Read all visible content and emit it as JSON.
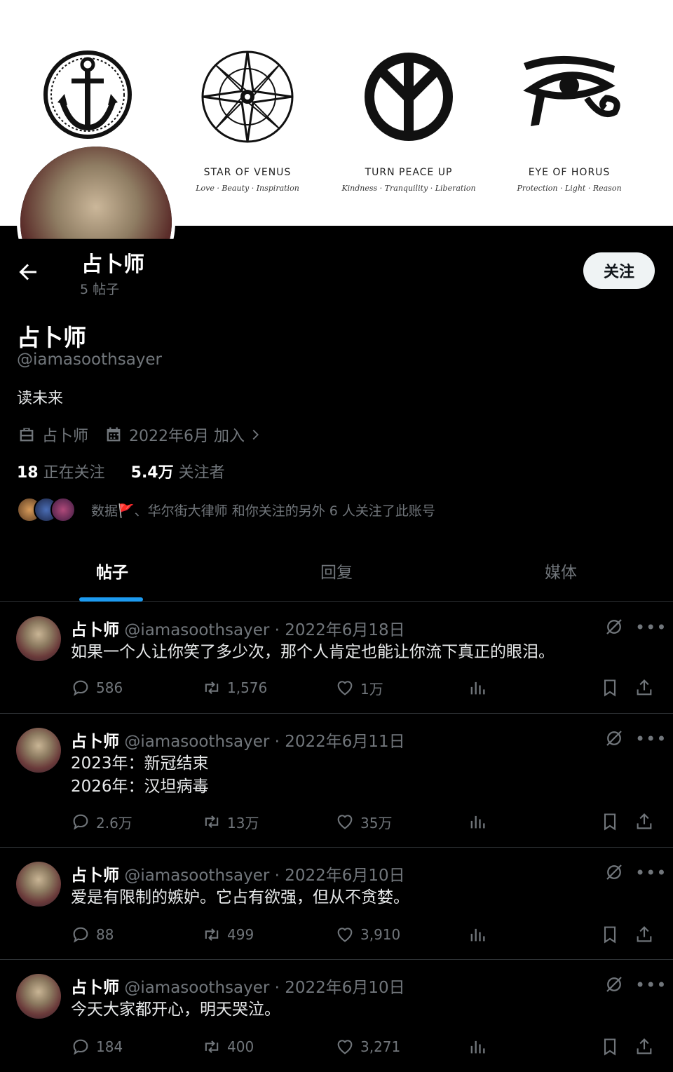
{
  "banner": {
    "symbols": [
      {
        "icon": "anchor-icon",
        "title": "",
        "subtitle": ""
      },
      {
        "icon": "compass-star-icon",
        "title": "STAR OF VENUS",
        "subtitle": "Love · Beauty · Inspiration"
      },
      {
        "icon": "peace-sign-icon",
        "title": "TURN PEACE UP",
        "subtitle": "Kindness · Tranquility · Liberation"
      },
      {
        "icon": "eye-of-horus-icon",
        "title": "EYE OF HORUS",
        "subtitle": "Protection · Light · Reason"
      }
    ]
  },
  "header": {
    "name": "占卜师",
    "post_count": "5 帖子",
    "follow_label": "关注"
  },
  "profile": {
    "name": "占卜师",
    "handle": "@iamasoothsayer",
    "bio": "读未来",
    "job": "占卜师",
    "joined": "2022年6月 加入",
    "following_count": "18",
    "following_label": "正在关注",
    "followers_count": "5.4万",
    "followers_label": "关注者",
    "known_followers": "数据🚩、华尔街大律师 和你关注的另外 6 人关注了此账号"
  },
  "tabs": [
    {
      "label": "帖子",
      "active": true
    },
    {
      "label": "回复",
      "active": false
    },
    {
      "label": "媒体",
      "active": false
    }
  ],
  "posts": [
    {
      "name": "占卜师",
      "meta": "@iamasoothsayer · 2022年6月18日",
      "lines": [
        "如果一个人让你笑了多少次，那个人肯定也能让你流下真正的眼泪。"
      ],
      "replies": "586",
      "reposts": "1,576",
      "likes": "1万"
    },
    {
      "name": "占卜师",
      "meta": "@iamasoothsayer · 2022年6月11日",
      "lines": [
        "2023年：新冠结束",
        "2026年：汉坦病毒"
      ],
      "replies": "2.6万",
      "reposts": "13万",
      "likes": "35万"
    },
    {
      "name": "占卜师",
      "meta": "@iamasoothsayer · 2022年6月10日",
      "lines": [
        "爱是有限制的嫉妒。它占有欲强，但从不贪婪。"
      ],
      "replies": "88",
      "reposts": "499",
      "likes": "3,910"
    },
    {
      "name": "占卜师",
      "meta": "@iamasoothsayer · 2022年6月10日",
      "lines": [
        "今天大家都开心，明天哭泣。"
      ],
      "replies": "184",
      "reposts": "400",
      "likes": "3,271"
    }
  ],
  "colors": {
    "accent": "#1d9bf0",
    "muted": "#71767b",
    "divider": "#2f3336"
  }
}
